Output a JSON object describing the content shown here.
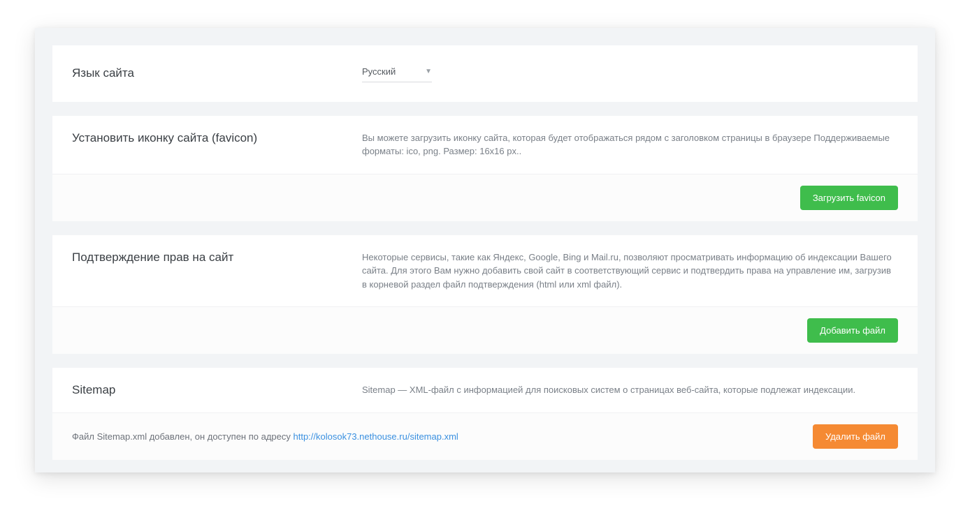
{
  "language": {
    "title": "Язык сайта",
    "selected": "Русский"
  },
  "favicon": {
    "title": "Установить иконку сайта (favicon)",
    "description": "Вы можете загрузить иконку сайта, которая будет отображаться рядом с заголовком страницы в браузере Поддерживаемые форматы: ico, png. Размер: 16x16 px..",
    "button": "Загрузить favicon"
  },
  "verification": {
    "title": "Подтверждение прав на сайт",
    "description": "Некоторые сервисы, такие как Яндекс, Google, Bing и Mail.ru, позволяют просматривать информацию об индексации Вашего сайта. Для этого Вам нужно добавить свой сайт в соответствующий сервис и подтвердить права на управление им, загрузив в корневой раздел файл подтверждения (html или xml файл).",
    "button": "Добавить файл"
  },
  "sitemap": {
    "title": "Sitemap",
    "description": "Sitemap — XML-файл с информацией для поисковых систем о страницах веб-сайта, которые подлежат индексации.",
    "status_prefix": "Файл Sitemap.xml добавлен, он доступен по адресу ",
    "url": "http://kolosok73.nethouse.ru/sitemap.xml",
    "button": "Удалить файл"
  }
}
